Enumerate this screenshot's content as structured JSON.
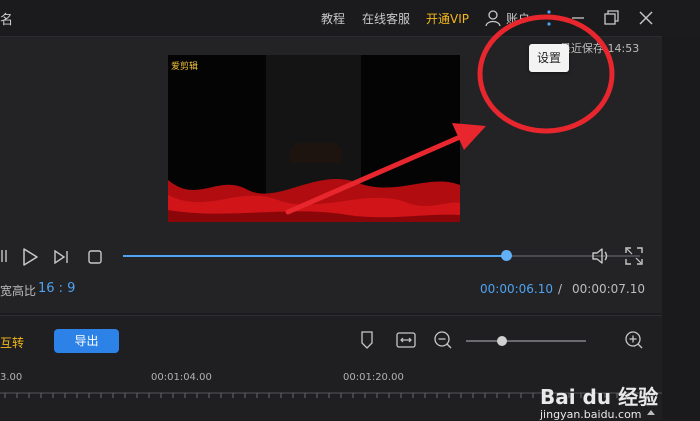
{
  "titlebar": {
    "title_fragment": "名",
    "nav": [
      "教程",
      "在线客服",
      "开通VIP"
    ],
    "account_label": "账户"
  },
  "preview": {
    "saved_text": "最近保存 14:53",
    "tooltip": "设置",
    "watermark": "爱剪辑",
    "progress": 0.74
  },
  "status": {
    "aspect_label": "宽高比",
    "aspect_value": "16 : 9",
    "time_current": "00:00:06.10",
    "time_separator": "/",
    "time_total": "00:00:07.10"
  },
  "timeline": {
    "edge_label": "互转",
    "export_label": "导出",
    "ticks": [
      "3.00",
      "00:01:04.00",
      "00:01:20.00"
    ],
    "zoom_level": 0.3
  },
  "watermark_site": {
    "brand": "Bai du 经验",
    "url": "jingyan.baidu.com"
  },
  "colors": {
    "accent": "#4fa3f2",
    "vip": "#f5b81c",
    "annotation": "#e8262d"
  }
}
